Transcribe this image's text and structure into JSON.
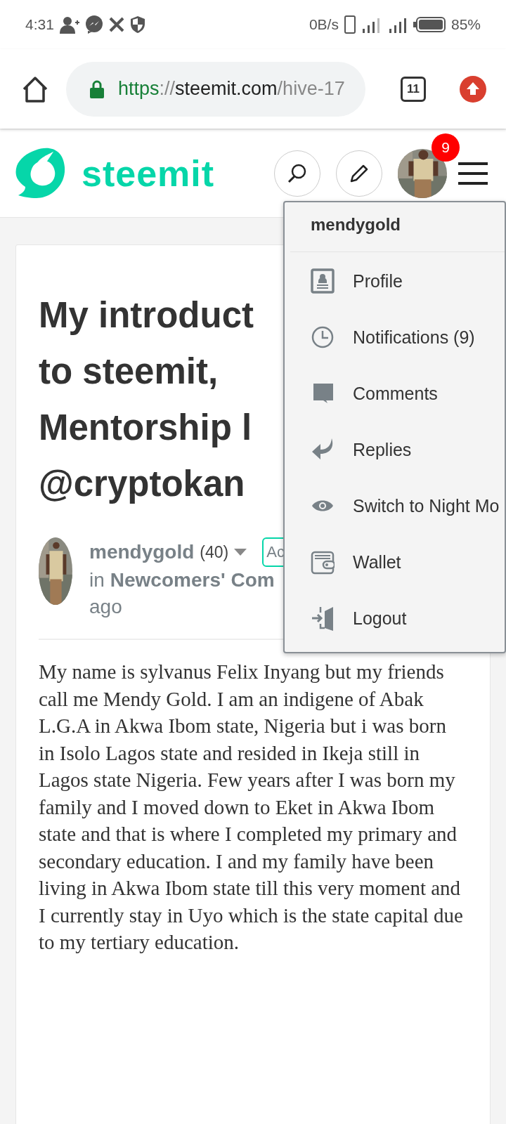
{
  "status_bar": {
    "time": "4:31",
    "speed": "0B/s",
    "battery": "85%"
  },
  "browser": {
    "url": {
      "scheme": "https",
      "separator": "://",
      "host": "steemit.com",
      "path": "/hive-17"
    },
    "tab_count": "11"
  },
  "header": {
    "logo": "steemit",
    "notification_count": "9"
  },
  "post": {
    "title_lines": [
      "My introduct",
      "to steemit,",
      "Mentorship l",
      "@cryptokan"
    ],
    "author": {
      "name": "mendygold",
      "reputation": "(40)",
      "tag": "Ac",
      "community_prefix": "in",
      "community": "Newcomers' Com",
      "time": "ago"
    },
    "body": "My name is sylvanus Felix Inyang but my friends call me Mendy Gold. I am an indigene of Abak L.G.A in Akwa Ibom state, Nigeria but i was born in Isolo Lagos state and resided in Ikeja still in Lagos state Nigeria. Few years after I was born my family and I moved down to Eket in Akwa Ibom state and that is where I completed my primary and secondary education. I and my family have been living in Akwa Ibom state till this very moment and I currently stay in Uyo which is the state capital due to my tertiary education."
  },
  "user_menu": {
    "username": "mendygold",
    "items": [
      {
        "kind": "profile",
        "label": "Profile"
      },
      {
        "kind": "notifications",
        "label": "Notifications (9)"
      },
      {
        "kind": "comments",
        "label": "Comments"
      },
      {
        "kind": "replies",
        "label": "Replies"
      },
      {
        "kind": "night",
        "label": "Switch to Night Mo"
      },
      {
        "kind": "wallet",
        "label": "Wallet"
      },
      {
        "kind": "logout",
        "label": "Logout"
      }
    ]
  }
}
